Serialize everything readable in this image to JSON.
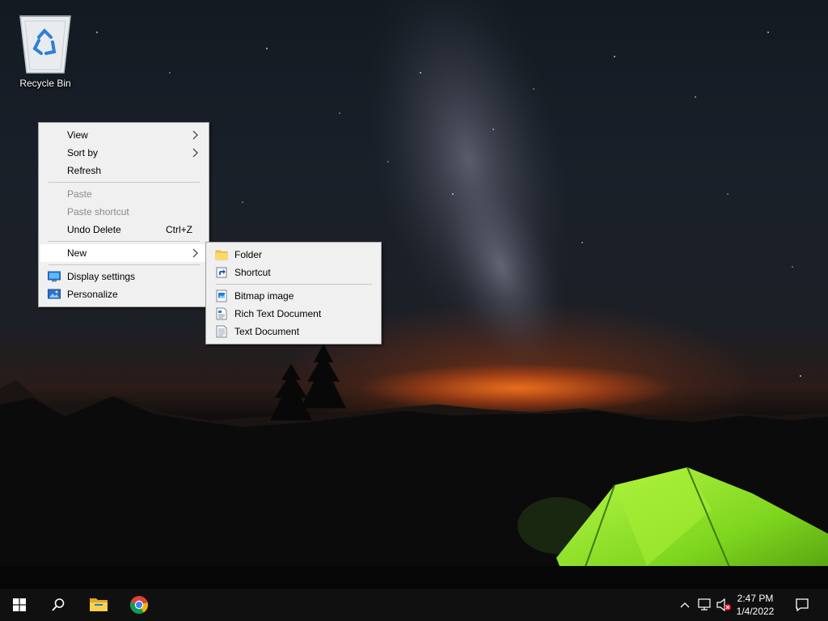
{
  "desktop": {
    "recycle_bin_label": "Recycle Bin"
  },
  "context_menu": {
    "view": "View",
    "sort_by": "Sort by",
    "refresh": "Refresh",
    "paste": "Paste",
    "paste_shortcut": "Paste shortcut",
    "undo_delete": "Undo Delete",
    "undo_shortcut": "Ctrl+Z",
    "new": "New",
    "display_settings": "Display settings",
    "personalize": "Personalize"
  },
  "new_submenu": {
    "folder": "Folder",
    "shortcut": "Shortcut",
    "bitmap_image": "Bitmap image",
    "rich_text_document": "Rich Text Document",
    "text_document": "Text Document"
  },
  "taskbar": {
    "time": "2:47 PM",
    "date": "1/4/2022",
    "pinned": [
      "start-icon",
      "search-icon",
      "file-explorer-icon",
      "chrome-icon"
    ],
    "tray_icons": [
      "chevron-up-icon",
      "network-icon",
      "volume-muted-icon",
      "notification-icon"
    ]
  },
  "colors": {
    "menu_bg": "#f0f0f0",
    "menu_hover": "#ffffff",
    "taskbar_bg": "#101010",
    "start_blue": "#ffffff",
    "tent_green": "#8fe02a"
  }
}
